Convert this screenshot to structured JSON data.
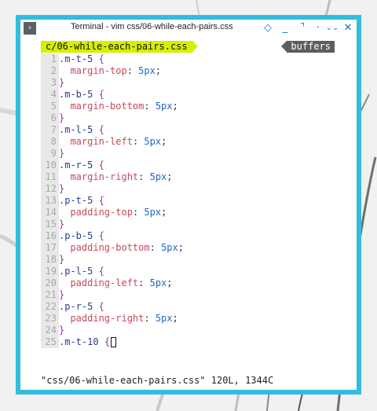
{
  "window": {
    "title": "Terminal - vim css/06-while-each-pairs.css",
    "app_icon_glyph": "›",
    "controls": {
      "pin": "◇",
      "minimize": "_",
      "maximize": "⌝",
      "shade": "·",
      "menu": "⌄⌄",
      "close": "✕"
    }
  },
  "vim": {
    "active_tab": "c/06-while-each-pairs.css",
    "buffers_label": "buffers",
    "lines": [
      {
        "n": "1",
        "sel": ".m-t-5",
        "brace": "{"
      },
      {
        "n": "2",
        "prop": "margin-top",
        "val": "5px"
      },
      {
        "n": "3",
        "close": "}"
      },
      {
        "n": "4",
        "sel": ".m-b-5",
        "brace": "{"
      },
      {
        "n": "5",
        "prop": "margin-bottom",
        "val": "5px"
      },
      {
        "n": "6",
        "close": "}"
      },
      {
        "n": "7",
        "sel": ".m-l-5",
        "brace": "{"
      },
      {
        "n": "8",
        "prop": "margin-left",
        "val": "5px"
      },
      {
        "n": "9",
        "close": "}"
      },
      {
        "n": "10",
        "sel": ".m-r-5",
        "brace": "{"
      },
      {
        "n": "11",
        "prop": "margin-right",
        "val": "5px"
      },
      {
        "n": "12",
        "close": "}"
      },
      {
        "n": "13",
        "sel": ".p-t-5",
        "brace": "{"
      },
      {
        "n": "14",
        "prop": "padding-top",
        "val": "5px"
      },
      {
        "n": "15",
        "close": "}"
      },
      {
        "n": "16",
        "sel": ".p-b-5",
        "brace": "{"
      },
      {
        "n": "17",
        "prop": "padding-bottom",
        "val": "5px"
      },
      {
        "n": "18",
        "close": "}"
      },
      {
        "n": "19",
        "sel": ".p-l-5",
        "brace": "{"
      },
      {
        "n": "20",
        "prop": "padding-left",
        "val": "5px"
      },
      {
        "n": "21",
        "close": "}"
      },
      {
        "n": "22",
        "sel": ".p-r-5",
        "brace": "{"
      },
      {
        "n": "23",
        "prop": "padding-right",
        "val": "5px"
      },
      {
        "n": "24",
        "close": "}"
      },
      {
        "n": "25",
        "sel": ".m-t-10",
        "brace": "{",
        "cursor": true
      }
    ],
    "status_message": "\"css/06-while-each-pairs.css\" 120L, 1344C"
  },
  "colors": {
    "window_border": "#30bdde",
    "tab_active": "#d7ef00",
    "tab_buffers": "#5d5d5d",
    "selector": "#2b3a8c",
    "brace": "#9b2fae",
    "property": "#c64a5a",
    "value": "#1f66c4"
  }
}
